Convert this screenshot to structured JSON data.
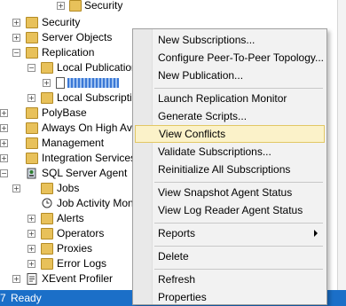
{
  "tree": {
    "items": [
      {
        "label": "Security",
        "expander": "+",
        "icon": "folder-icon"
      },
      {
        "label": "Security",
        "expander": "+",
        "icon": "folder-icon"
      },
      {
        "label": "Server Objects",
        "expander": "+",
        "icon": "folder-icon"
      },
      {
        "label": "Replication",
        "expander": "−",
        "icon": "folder-icon"
      },
      {
        "label": "Local Publications",
        "expander": "−",
        "icon": "folder-icon"
      },
      {
        "label": "",
        "expander": "+",
        "icon": "publication-icon"
      },
      {
        "label": "Local Subscriptions",
        "expander": "+",
        "icon": "folder-icon"
      },
      {
        "label": "PolyBase",
        "expander": "+",
        "icon": "folder-icon"
      },
      {
        "label": "Always On High Availa",
        "expander": "+",
        "icon": "folder-icon"
      },
      {
        "label": "Management",
        "expander": "+",
        "icon": "folder-icon"
      },
      {
        "label": "Integration Services Ca",
        "expander": "+",
        "icon": "folder-icon"
      },
      {
        "label": "SQL Server Agent",
        "expander": "−",
        "icon": "agent-icon"
      },
      {
        "label": "Jobs",
        "expander": "+",
        "icon": "folder-icon"
      },
      {
        "label": "Job Activity Monitor",
        "expander": "",
        "icon": "monitor-icon"
      },
      {
        "label": "Alerts",
        "expander": "+",
        "icon": "folder-icon"
      },
      {
        "label": "Operators",
        "expander": "+",
        "icon": "folder-icon"
      },
      {
        "label": "Proxies",
        "expander": "+",
        "icon": "folder-icon"
      },
      {
        "label": "Error Logs",
        "expander": "+",
        "icon": "folder-icon"
      },
      {
        "label": "XEvent Profiler",
        "expander": "+",
        "icon": "profiler-icon"
      }
    ]
  },
  "context_menu": {
    "items": [
      "New Subscriptions...",
      "Configure Peer-To-Peer Topology...",
      "New Publication...",
      "Launch Replication Monitor",
      "Generate Scripts...",
      "View Conflicts",
      "Validate Subscriptions...",
      "Reinitialize All Subscriptions",
      "View Snapshot Agent Status",
      "View Log Reader Agent Status",
      "Reports",
      "Delete",
      "Refresh",
      "Properties"
    ],
    "highlighted": "View Conflicts"
  },
  "status": {
    "left_number": "7",
    "text": "Ready"
  },
  "colors": {
    "status_bar": "#1b6fc8",
    "menu_highlight": "#fbf2c9",
    "selection": "#3a78d6"
  }
}
